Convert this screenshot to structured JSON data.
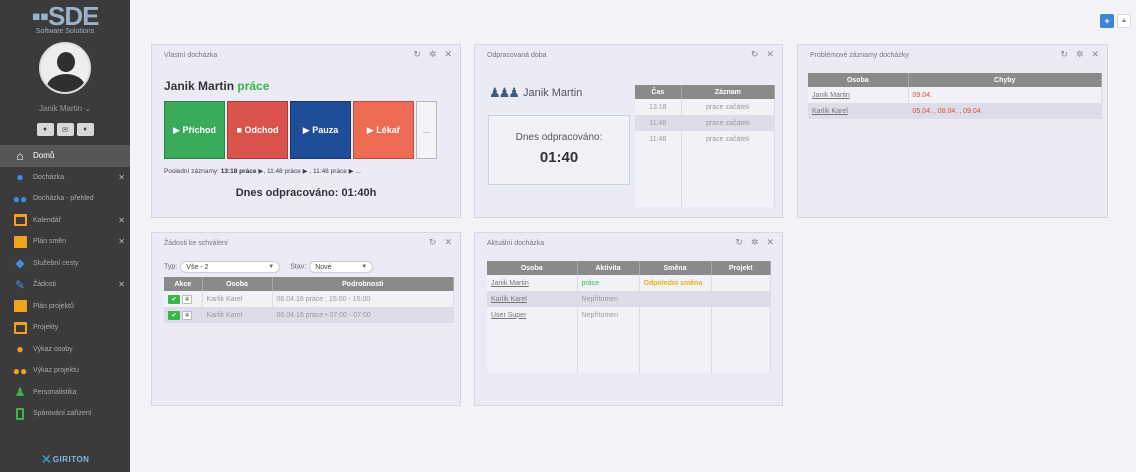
{
  "brand": {
    "logo_text": "SDE",
    "logo_sub": "Software Solutions",
    "footer": "GIRITON"
  },
  "user": {
    "name": "Janik Martin"
  },
  "menu": [
    {
      "label": "Domů",
      "icon": "home-icon",
      "active": true,
      "closable": false
    },
    {
      "label": "Docházka",
      "icon": "person-icon",
      "active": false,
      "closable": true
    },
    {
      "label": "Docházka - přehled",
      "icon": "people-icon",
      "active": false,
      "closable": false
    },
    {
      "label": "Kalendář",
      "icon": "calendar-icon",
      "active": false,
      "closable": true
    },
    {
      "label": "Plán směn",
      "icon": "calendar-grid-icon",
      "active": false,
      "closable": true
    },
    {
      "label": "Služební cesty",
      "icon": "car-icon",
      "active": false,
      "closable": false
    },
    {
      "label": "Žádosti",
      "icon": "wrench-icon",
      "active": false,
      "closable": true
    },
    {
      "label": "Plán projektů",
      "icon": "calendar-grid-icon",
      "active": false,
      "closable": false
    },
    {
      "label": "Projekty",
      "icon": "calendar-icon",
      "active": false,
      "closable": false
    },
    {
      "label": "Výkaz osoby",
      "icon": "person-icon",
      "active": false,
      "closable": false
    },
    {
      "label": "Výkaz projektu",
      "icon": "people-icon",
      "active": false,
      "closable": false
    },
    {
      "label": "Personalistika",
      "icon": "person-standing-icon",
      "active": false,
      "closable": false
    },
    {
      "label": "Spárování zařízení",
      "icon": "phone-icon",
      "active": false,
      "closable": false
    }
  ],
  "own_attendance": {
    "title": "Vlastní docházka",
    "person": "Janik Martin",
    "status": "práce",
    "buttons": {
      "arrival": "Příchod",
      "departure": "Odchod",
      "pause": "Pauza",
      "doctor": "Lékař",
      "more": "..."
    },
    "last_records_label": "Poslední záznamy:",
    "last_records_first": "13:18 práce",
    "last_records_rest": ", 11:48 práce ▶ , 11:48 práce ▶ ...",
    "today": "Dnes odpracováno: 01:40h"
  },
  "worked_time": {
    "title": "Odpracovaná doba",
    "person": "Janik Martin",
    "today_label": "Dnes odpracováno:",
    "today_value": "01:40",
    "columns": [
      "Čas",
      "Záznam"
    ],
    "rows": [
      [
        "13:18",
        "práce začátek"
      ],
      [
        "11:48",
        "práce začátek"
      ],
      [
        "11:48",
        "práce začátek"
      ]
    ]
  },
  "problem_records": {
    "title": "Problémové záznamy docházky",
    "columns": [
      "Osoba",
      "Chyby"
    ],
    "rows": [
      {
        "person": "Janik Martin",
        "errors": "09.04."
      },
      {
        "person": "Karlik Karel",
        "errors": "05.04. , 08.04. , 09.04."
      }
    ]
  },
  "requests": {
    "title": "Žádosti ke schválení",
    "type_label": "Typ:",
    "type_value": "Vše - 2",
    "state_label": "Stav:",
    "state_value": "Nové",
    "columns": [
      "Akce",
      "Osoba",
      "Podrobnosti"
    ],
    "rows": [
      {
        "person": "Karlik Karel",
        "details": "06.04.16 práce : 15:00 - 15:00"
      },
      {
        "person": "Karlik Karel",
        "details": "06.04.16 práce • 07:00 - 07:00"
      }
    ]
  },
  "current_attendance": {
    "title": "Aktuální docházka",
    "columns": [
      "Osoba",
      "Aktivita",
      "Směna",
      "Projekt"
    ],
    "rows": [
      {
        "person": "Janik Martin",
        "activity": "práce",
        "shift": "Odpolední směna",
        "project": ""
      },
      {
        "person": "Karlik Karel",
        "activity": "Nepřítomen",
        "shift": "",
        "project": ""
      },
      {
        "person": "User Super",
        "activity": "Nepřítomen",
        "shift": "",
        "project": ""
      }
    ]
  },
  "colors": {
    "sidebar": "#3b3b3b",
    "accent_blue": "#3c84d6",
    "green": "#3aaa5b",
    "red": "#d9524b",
    "navy": "#1f4d97",
    "orange": "#ee6b53"
  }
}
